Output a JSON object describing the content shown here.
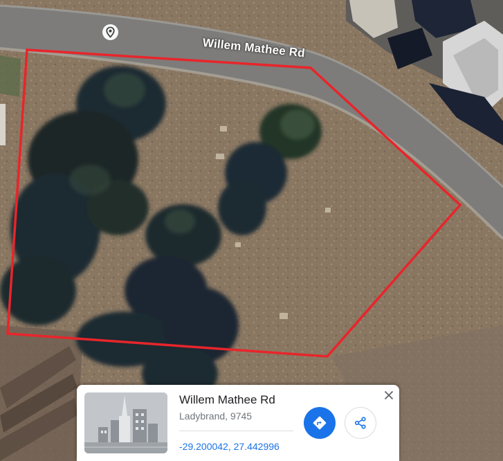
{
  "map": {
    "road_name": "Willem Mathee Rd",
    "boundary_color": "#e8252b",
    "marker_icon": "location-pin-icon"
  },
  "card": {
    "title": "Willem Mathee Rd",
    "subtitle": "Ladybrand, 9745",
    "coordinates": "-29.200042, 27.442996",
    "directions_icon": "directions-icon",
    "share_icon": "share-icon",
    "close_icon": "close-icon",
    "thumbnail_icon": "city-thumbnail-icon",
    "accent_color": "#1a73e8"
  }
}
